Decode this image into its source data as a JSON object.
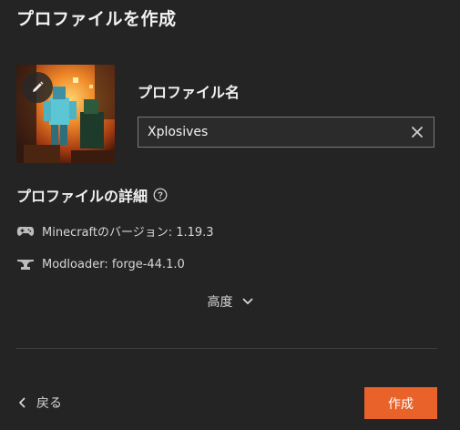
{
  "dialog": {
    "title": "プロファイルを作成"
  },
  "profile_image": {
    "icon": "pencil-icon"
  },
  "profile_name": {
    "label": "プロファイル名",
    "value": "Xplosives",
    "clear_icon": "close-icon"
  },
  "details": {
    "heading": "プロファイルの詳細",
    "help_icon": "help-circle-icon",
    "version": {
      "icon": "gamepad-icon",
      "text": "Minecraftのバージョン: 1.19.3"
    },
    "modloader": {
      "icon": "anvil-icon",
      "text": "Modloader: forge-44.1.0"
    }
  },
  "advanced": {
    "label": "高度",
    "icon": "chevron-down-icon"
  },
  "footer": {
    "back_label": "戻る",
    "back_icon": "chevron-left-icon",
    "create_label": "作成"
  },
  "colors": {
    "background": "#242424",
    "accent": "#e8622a",
    "text": "#e8e8e8"
  }
}
